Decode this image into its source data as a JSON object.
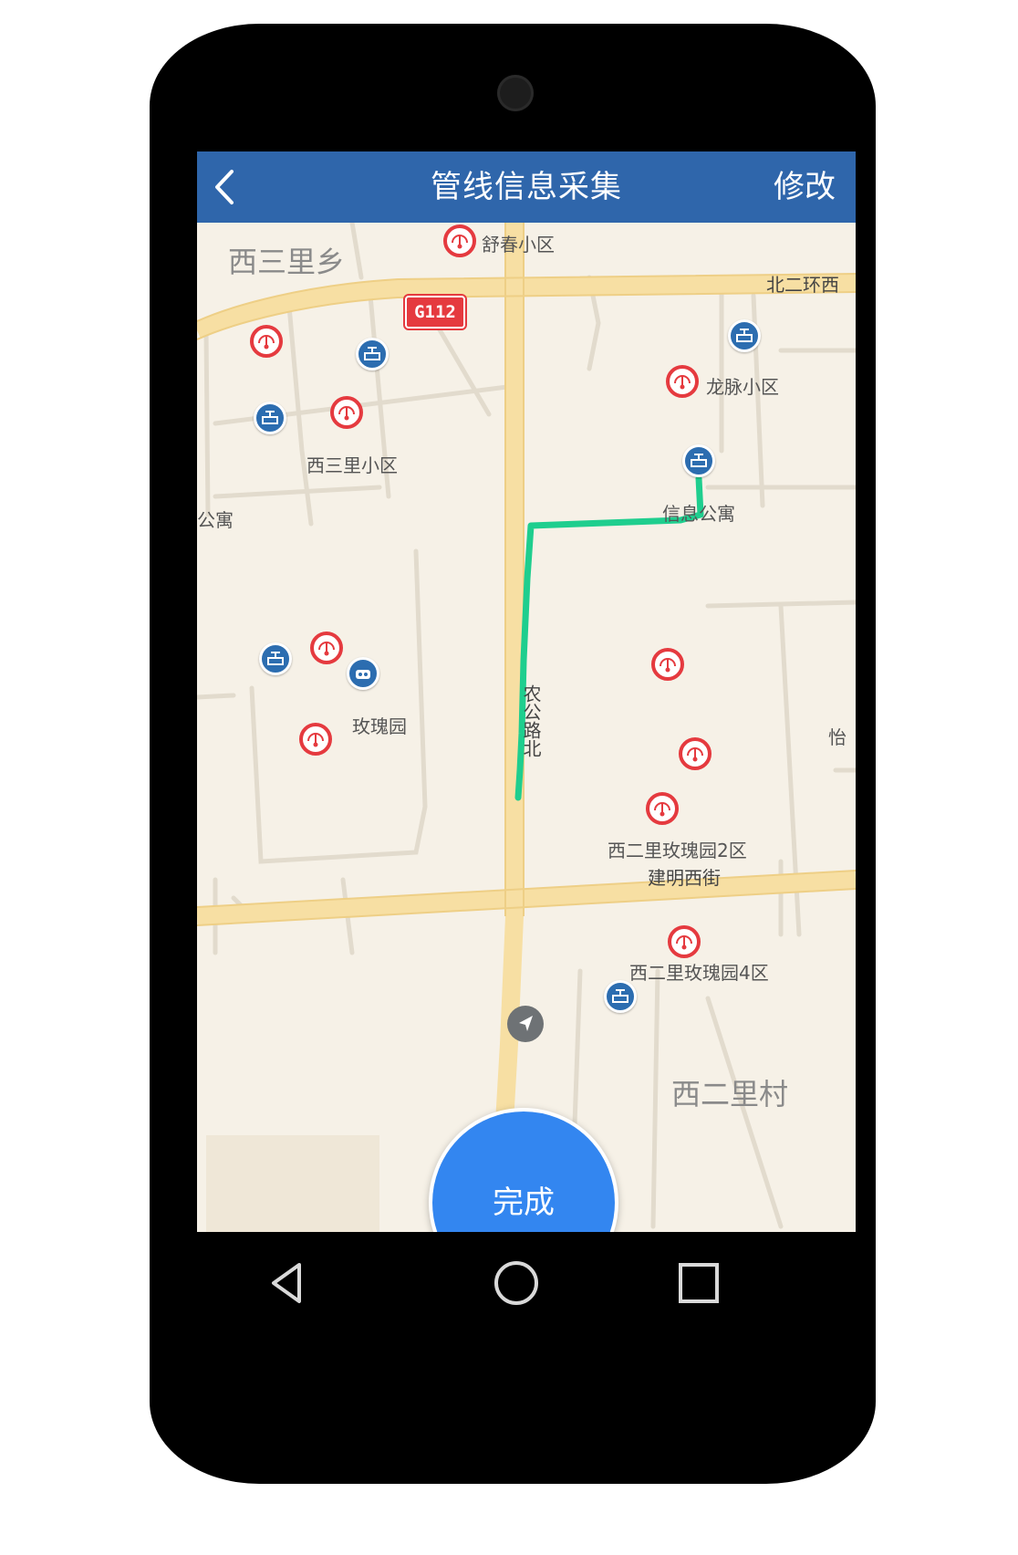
{
  "app": {
    "title": "管线信息采集",
    "back_icon": "chevron-left-icon",
    "edit_label": "修改",
    "header_color": "#2f66ab"
  },
  "map": {
    "places": {
      "district_xisanli": "西三里乡",
      "district_xierli": "西二里村",
      "shuchun": "舒春小区",
      "longmai": "龙脉小区",
      "xisanli_xiaoqu": "西三里小区",
      "xinxi_gongyu": "信息公寓",
      "gongyu_edge": "公寓",
      "meigui_yuan": "玫瑰园",
      "xierli_2qu": "西二里玫瑰园2区",
      "xierli_4qu": "西二里玫瑰园4区",
      "yi_edge": "怡"
    },
    "roads": {
      "beierhuan": "北二环西",
      "jianming": "建明西街",
      "gongnong": "农公路北",
      "g112": "G112"
    },
    "marker_types": {
      "red": "gauge-icon",
      "blue": "valve-icon",
      "blue_alt": "pump-icon"
    },
    "route_color": "#1fce8e",
    "location_icon": "navigation-arrow-icon"
  },
  "actions": {
    "done_label": "完成",
    "done_color": "#3386f0"
  },
  "nav": {
    "back": "nav-back-icon",
    "home": "nav-home-icon",
    "recents": "nav-recents-icon"
  }
}
